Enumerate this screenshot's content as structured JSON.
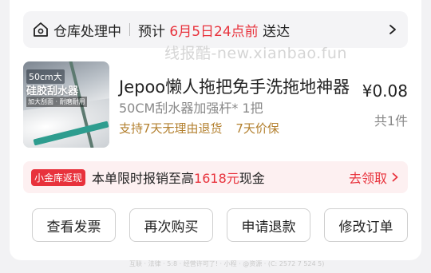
{
  "status": {
    "label": "仓库处理中",
    "eta_prefix": "预计",
    "eta_date": "6月5日24点前",
    "eta_suffix": "送达",
    "icon": "house-icon"
  },
  "watermark": "线报酷-new.xianbao.fun",
  "product": {
    "image_tags": [
      "50cm大",
      "硅胶刮水器",
      "加大刮面 · 耐磨耐用"
    ],
    "title": "Jepoo懒人拖把免手洗拖地神器",
    "spec": "50CM刮水器加强杆* 1把",
    "services": [
      "支持7天无理由退货",
      "7天价保"
    ],
    "price": "¥0.08",
    "quantity": "共1件"
  },
  "promo": {
    "badge": "小金库返现",
    "text_prefix": "本单限时报销至高",
    "amount": "1618元",
    "text_suffix": "现金",
    "cta": "去领取"
  },
  "actions": [
    "查看发票",
    "再次购买",
    "申请退款",
    "修改订单"
  ],
  "footer_note": "互联 · 法律 · 5:8 · 经营许可了! · 小程 · @资源 · (C: 2572 7 524 5)",
  "colors": {
    "accent": "#e8323c",
    "service": "#b3802f",
    "background": "#f2f2f4"
  }
}
